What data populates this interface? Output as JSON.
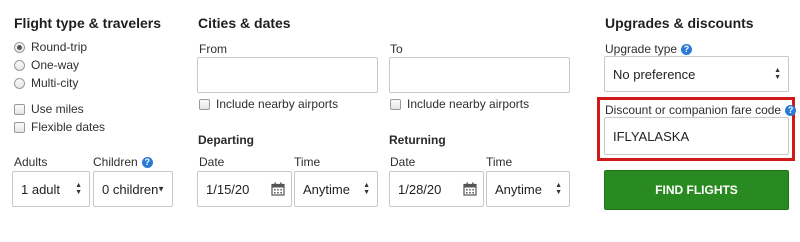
{
  "sections": {
    "flight_type_title": "Flight type & travelers",
    "cities_title": "Cities & dates",
    "upgrades_title": "Upgrades & discounts"
  },
  "flight_type": {
    "options": [
      "Round-trip",
      "One-way",
      "Multi-city"
    ],
    "selected": "Round-trip"
  },
  "extras": {
    "use_miles": "Use miles",
    "flexible_dates": "Flexible dates"
  },
  "travelers": {
    "adults_label": "Adults",
    "adults_value": "1 adult",
    "children_label": "Children",
    "children_value": "0 children"
  },
  "cities": {
    "from_label": "From",
    "from_value": "",
    "to_label": "To",
    "to_value": "",
    "nearby_label": "Include nearby airports"
  },
  "departing": {
    "title": "Departing",
    "date_label": "Date",
    "date_value": "1/15/20",
    "time_label": "Time",
    "time_value": "Anytime"
  },
  "returning": {
    "title": "Returning",
    "date_label": "Date",
    "date_value": "1/28/20",
    "time_label": "Time",
    "time_value": "Anytime"
  },
  "upgrades": {
    "upgrade_type_label": "Upgrade type",
    "upgrade_type_value": "No preference",
    "discount_label": "Discount or companion fare code",
    "discount_value": "IFLYALASKA",
    "find_button": "FIND FLIGHTS"
  },
  "colors": {
    "accent_green": "#2a8a22",
    "highlight_red": "#d01a1a",
    "info_blue": "#2a7ad6"
  }
}
